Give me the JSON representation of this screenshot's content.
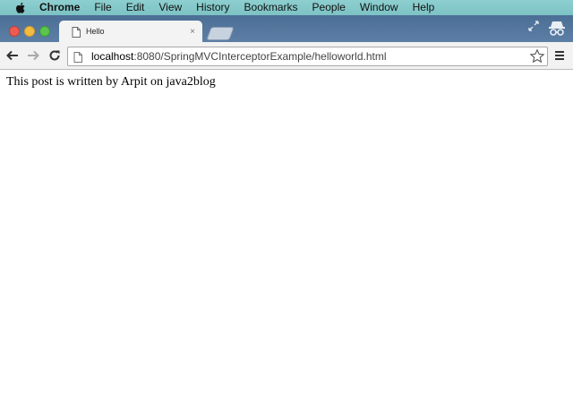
{
  "menubar": {
    "app_name": "Chrome",
    "items": [
      "File",
      "Edit",
      "View",
      "History",
      "Bookmarks",
      "People",
      "Window",
      "Help"
    ]
  },
  "tab": {
    "title": "Hello",
    "close_glyph": "×"
  },
  "address_bar": {
    "url_host": "localhost",
    "url_rest": ":8080/SpringMVCInterceptorExample/helloworld.html"
  },
  "page": {
    "text": "This post is written by Arpit on java2blog"
  },
  "colors": {
    "menubar": "#8ecfd0",
    "tabstrip": "#4b6e95",
    "toolbar": "#f2f2f2"
  },
  "icons": [
    "apple-logo-icon",
    "page-icon",
    "back-arrow-icon",
    "forward-arrow-icon",
    "reload-icon",
    "star-icon",
    "hamburger-menu-icon",
    "incognito-icon",
    "restore-icon"
  ]
}
